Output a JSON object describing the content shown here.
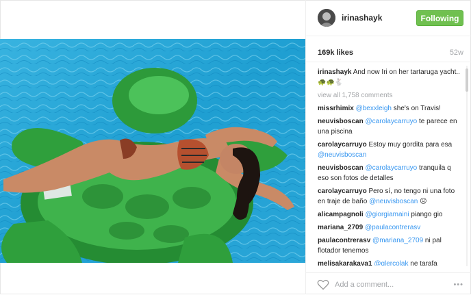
{
  "post": {
    "username": "irinashayk",
    "follow_label": "Following",
    "likes": "169k likes",
    "age": "52w"
  },
  "caption": {
    "username": "irinashayk",
    "text": "And now Iri on her tartaruga yacht.. 🐢🐢🐇"
  },
  "view_all": "view all 1,758 comments",
  "comments": [
    {
      "user": "missrhimix",
      "mention": "@bexxleigh",
      "text": " she's on Travis!"
    },
    {
      "user": "neuvisboscan",
      "mention": "@carolaycarruyo",
      "text": " te parece en una piscina"
    },
    {
      "user": "carolaycarruyo",
      "mention": "",
      "text": "Estoy muy gordita para esa ",
      "mention2": "@neuvisboscan"
    },
    {
      "user": "neuvisboscan",
      "mention": "@carolaycarruyo",
      "text": " tranquila q eso son fotos de detalles"
    },
    {
      "user": "carolaycarruyo",
      "mention": "",
      "text": "Pero sí, no tengo ni una foto en traje de baño ",
      "mention2": "@neuvisboscan",
      "emoji": " ☹"
    },
    {
      "user": "alicampagnoli",
      "mention": "@giorgiamaini",
      "text": " piango gio"
    },
    {
      "user": "mariana_2709",
      "mention": "@paulacontrerasv",
      "text": ""
    },
    {
      "user": "paulacontrerasv",
      "mention": "@mariana_2709",
      "text": " ni pal flotador tenemos"
    },
    {
      "user": "melisakarakaya1",
      "mention": "@glercolak",
      "text": " ne tarafa agliyoruz?"
    }
  ],
  "footer": {
    "placeholder": "Add a comment...",
    "more": "•••"
  },
  "icons": {
    "heart": "heart-icon",
    "avatar": "avatar"
  }
}
